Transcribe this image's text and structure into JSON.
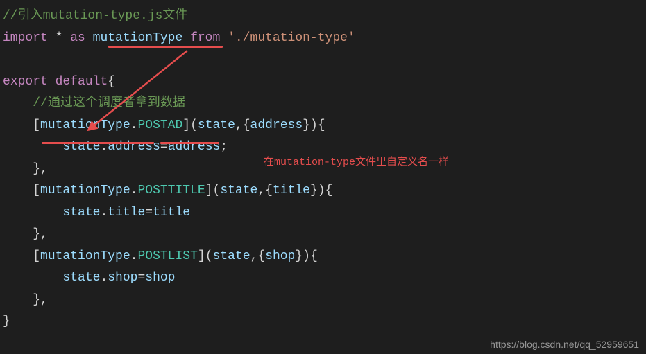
{
  "code": {
    "l1_comment": "//引入mutation-type.js文件",
    "l2_import": "import",
    "l2_star": " * ",
    "l2_as": "as",
    "l2_space1": " ",
    "l2_mutationType": "mutationType",
    "l2_space2": " ",
    "l2_from": "from",
    "l2_space3": " ",
    "l2_path": "'./mutation-type'",
    "l4_export": "export",
    "l4_space": " ",
    "l4_default": "default",
    "l4_brace": "{",
    "l5_comment": "//通过这个调度者拿到数据",
    "l6_open": "[",
    "l6_mutationType": "mutationType",
    "l6_dot": ".",
    "l6_POSTAD": "POSTAD",
    "l6_close": "]",
    "l6_sig_open": "(",
    "l6_state": "state",
    "l6_comma": ",",
    "l6_braceL": "{",
    "l6_address": "address",
    "l6_braceR": "}",
    "l6_sig_close": ")",
    "l6_fn_brace": "{",
    "l7_state": "state",
    "l7_dot": ".",
    "l7_address1": "address",
    "l7_eq": "=",
    "l7_address2": "address",
    "l7_semi": ";",
    "l8_close": "},",
    "l9_open": "[",
    "l9_mutationType": "mutationType",
    "l9_dot": ".",
    "l9_POSTTITLE": "POSTTITLE",
    "l9_close": "]",
    "l9_sig_open": "(",
    "l9_state": "state",
    "l9_comma": ",",
    "l9_braceL": "{",
    "l9_title": "title",
    "l9_braceR": "}",
    "l9_sig_close": ")",
    "l9_fn_brace": "{",
    "l10_state": "state",
    "l10_dot": ".",
    "l10_title1": "title",
    "l10_eq": "=",
    "l10_title2": "title",
    "l11_close": "},",
    "l12_open": "[",
    "l12_mutationType": "mutationType",
    "l12_dot": ".",
    "l12_POSTLIST": "POSTLIST",
    "l12_close": "]",
    "l12_sig_open": "(",
    "l12_state": "state",
    "l12_comma": ",",
    "l12_braceL": "{",
    "l12_shop": "shop",
    "l12_braceR": "}",
    "l12_sig_close": ")",
    "l12_fn_brace": "{",
    "l13_state": "state",
    "l13_dot": ".",
    "l13_shop1": "shop",
    "l13_eq": "=",
    "l13_shop2": "shop",
    "l14_close": "},",
    "l15_brace": "}"
  },
  "annotation": {
    "text": "在mutation-type文件里自定义名一样"
  },
  "watermark": "https://blog.csdn.net/qq_52959651"
}
